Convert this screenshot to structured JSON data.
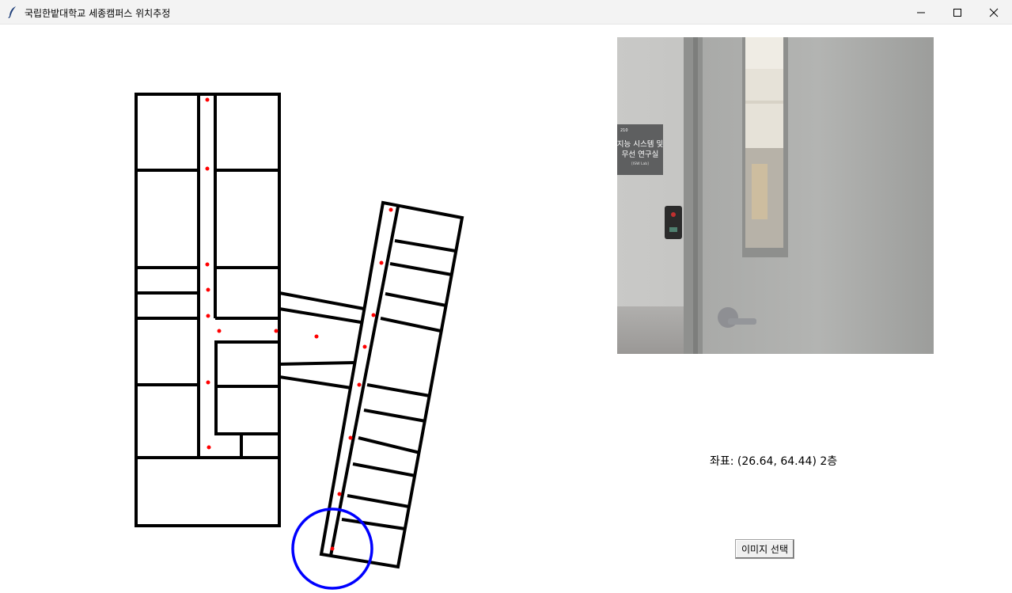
{
  "window": {
    "title": "국립한밭대학교 세종캠퍼스 위치추정",
    "icon": "feather-icon"
  },
  "photo": {
    "sign_room": "210",
    "sign_line1": "지능 시스템 및",
    "sign_line2": "무선 연구실",
    "sign_sub": "[ISW Lab]"
  },
  "result": {
    "coordinate_text": "좌표: (26.64, 64.44) 2층"
  },
  "controls": {
    "select_image_label": "이미지 선택"
  },
  "colors": {
    "wall": "#000000",
    "waypoint": "#ff0000",
    "location_circle": "#0000ff"
  }
}
